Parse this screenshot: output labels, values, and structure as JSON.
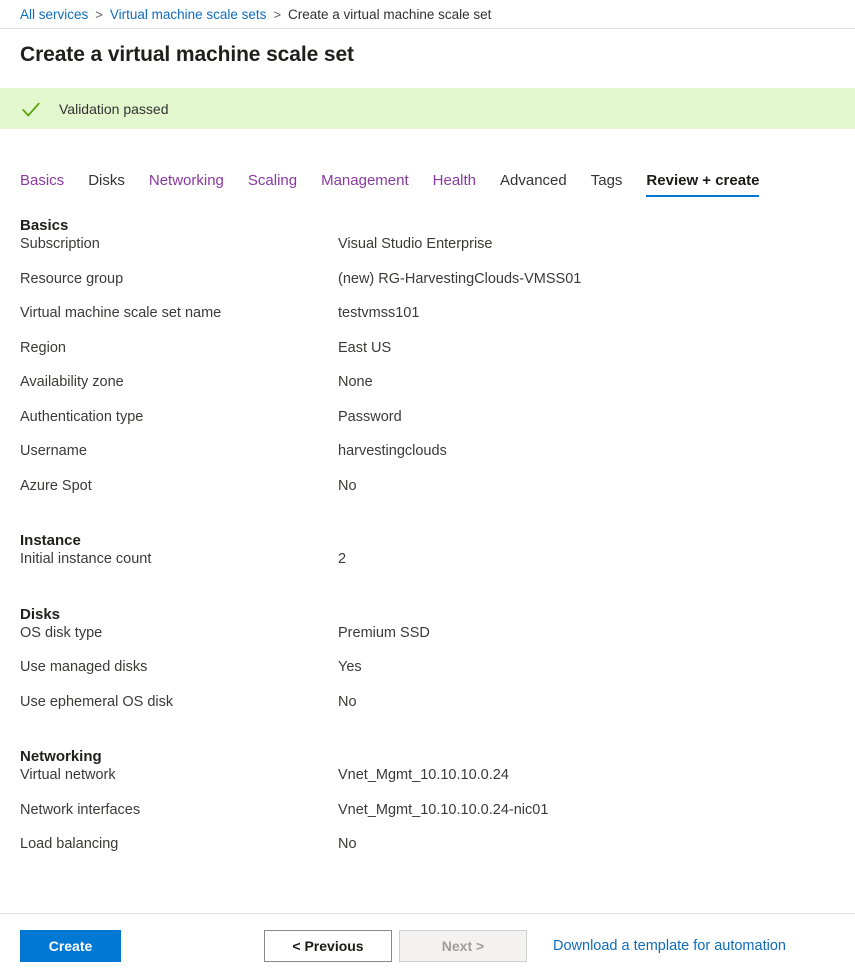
{
  "breadcrumb": {
    "items": [
      {
        "label": "All services",
        "link": true
      },
      {
        "label": "Virtual machine scale sets",
        "link": true
      },
      {
        "label": "Create a virtual machine scale set",
        "link": false
      }
    ],
    "separator": ">"
  },
  "page": {
    "title": "Create a virtual machine scale set"
  },
  "banner": {
    "icon": "checkmark-icon",
    "text": "Validation passed",
    "background_color": "#e3f7cf",
    "icon_color": "#57a300"
  },
  "tabs": {
    "items": [
      {
        "label": "Basics",
        "state": "visited"
      },
      {
        "label": "Disks",
        "state": "neutral"
      },
      {
        "label": "Networking",
        "state": "visited"
      },
      {
        "label": "Scaling",
        "state": "visited"
      },
      {
        "label": "Management",
        "state": "visited"
      },
      {
        "label": "Health",
        "state": "visited"
      },
      {
        "label": "Advanced",
        "state": "neutral"
      },
      {
        "label": "Tags",
        "state": "neutral"
      },
      {
        "label": "Review + create",
        "state": "active"
      }
    ],
    "active_underline_color": "#0078d4",
    "visited_color": "#8a39a0"
  },
  "sections": [
    {
      "heading": "Basics",
      "rows": [
        {
          "label": "Subscription",
          "value": "Visual Studio Enterprise"
        },
        {
          "label": "Resource group",
          "value": "(new) RG-HarvestingClouds-VMSS01"
        },
        {
          "label": "Virtual machine scale set name",
          "value": "testvmss101"
        },
        {
          "label": "Region",
          "value": "East US"
        },
        {
          "label": "Availability zone",
          "value": "None"
        },
        {
          "label": "Authentication type",
          "value": "Password"
        },
        {
          "label": "Username",
          "value": "harvestingclouds"
        },
        {
          "label": "Azure Spot",
          "value": "No"
        }
      ]
    },
    {
      "heading": "Instance",
      "rows": [
        {
          "label": "Initial instance count",
          "value": "2"
        }
      ]
    },
    {
      "heading": "Disks",
      "rows": [
        {
          "label": "OS disk type",
          "value": "Premium SSD"
        },
        {
          "label": "Use managed disks",
          "value": "Yes"
        },
        {
          "label": "Use ephemeral OS disk",
          "value": "No"
        }
      ]
    },
    {
      "heading": "Networking",
      "rows": [
        {
          "label": "Virtual network",
          "value": "Vnet_Mgmt_10.10.10.0.24"
        },
        {
          "label": "Network interfaces",
          "value": "Vnet_Mgmt_10.10.10.0.24-nic01"
        },
        {
          "label": "Load balancing",
          "value": "No"
        }
      ]
    }
  ],
  "footer": {
    "create_label": "Create",
    "previous_label": "< Previous",
    "next_label": "Next >",
    "next_disabled": true,
    "download_link_label": "Download a template for automation",
    "primary_color": "#0078d4",
    "link_color": "#0f6cbd"
  }
}
